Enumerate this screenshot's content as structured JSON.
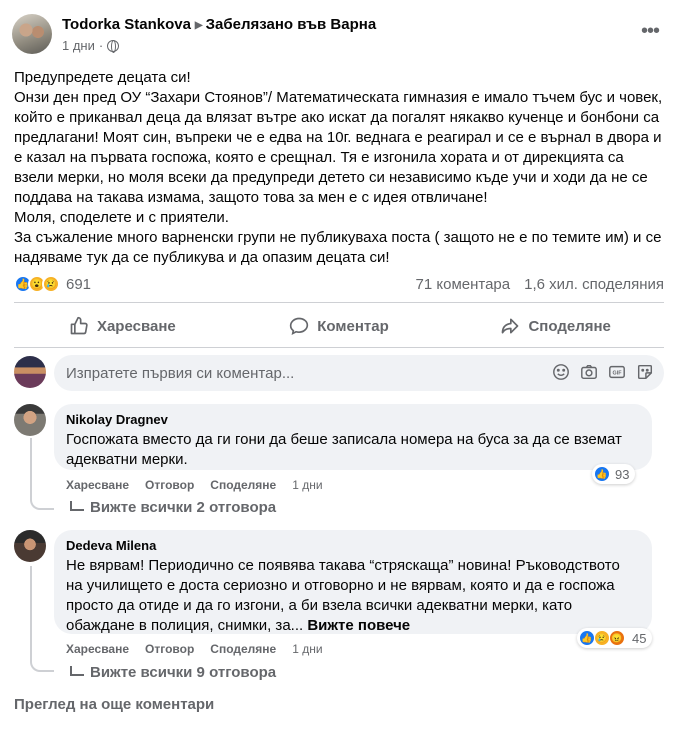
{
  "post": {
    "author": "Todorka Stankova",
    "location_text": "Забелязано във Варна",
    "time": "1 дни",
    "more_label": "•••",
    "paragraphs": [
      "Предупредете децата си!",
      "Онзи ден пред ОУ “Захари Стоянов”/ Математическата гимназия е имало тъчем бус и човек, който е приканвал деца да влязат вътре ако искат да погалят някакво кученце и бонбони са предлагани! Моят син, въпреки че е едва на 10г. веднага е реагирал и се е върнал в двора и е казал на първата госпожа, която е срещнал. Тя е изгонила хората и от дирекцията са взели мерки, но моля всеки да предупреди детето си независимо къде учи и ходи да не се поддава на такава измама, защото това за мен е с идея отвличане!",
      "Моля, споделете и с приятели.",
      "За съжаление много варненски групи не публикуваха поста ( защото не е по темите им) и се надяваме тук да се публикува и да опазим децата си!"
    ]
  },
  "stats": {
    "reactions_count": "691",
    "reaction_icons": [
      "like",
      "wow",
      "sad"
    ],
    "comments_text": "71 коментара",
    "shares_text": "1,6 хил. споделяния"
  },
  "actions": {
    "like": "Харесване",
    "comment": "Коментар",
    "share": "Споделяне"
  },
  "composer": {
    "placeholder": "Изпратете първия си коментар...",
    "tools": [
      "emoji-icon",
      "camera-icon",
      "gif-icon",
      "sticker-icon"
    ]
  },
  "comments": [
    {
      "name": "Nikolay Dragnev",
      "text": "Госпожата вместо да ги гони да беше записала номера на буса за да се вземат адекватни мерки.",
      "like": "Харесване",
      "reply": "Отговор",
      "share": "Споделяне",
      "time": "1 дни",
      "reactions_count": "93",
      "replies_text": "Вижте всички 2 отговора"
    },
    {
      "name": "Dedeva Milena",
      "text": "Не вярвам! Периодично се появява такава “стряскаща” новина! Ръководството на училището е доста сериозно и отговорно и не вярвам, която и да е госпожа просто да отиде и да го изгони, а би взела всички адекватни мерки, като обаждане в полиция, снимки, за...",
      "see_more": "Вижте повече",
      "like": "Харесване",
      "reply": "Отговор",
      "share": "Споделяне",
      "time": "1 дни",
      "reactions_count": "45",
      "replies_text": "Вижте всички 9 отговора"
    }
  ],
  "more_comments": "Преглед на още коментари",
  "colors": {
    "like_blue": "#1877f2",
    "secondary_text": "#65676b",
    "bubble_bg": "#f0f2f5"
  }
}
